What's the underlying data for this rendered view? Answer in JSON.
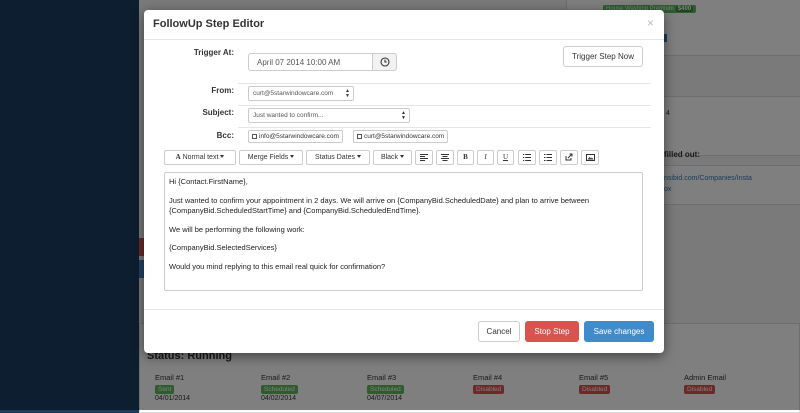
{
  "background": {
    "house_washing_label": "House Washing Premium",
    "house_washing_price": "$400",
    "number_fragment": "4",
    "filled_out_label": "filled out:",
    "link_line1": "nsibid.com/Companies/Insta",
    "link_line2": "ox",
    "status_title": "Status: Running",
    "emails": [
      {
        "header": "Email #1",
        "badge": "Sent",
        "date": "04/01/2014",
        "color": "#5cb85c"
      },
      {
        "header": "Email #2",
        "badge": "Scheduled",
        "date": "04/02/2014",
        "color": "#5cb85c"
      },
      {
        "header": "Email #3",
        "badge": "Scheduled",
        "date": "04/07/2014",
        "color": "#5cb85c"
      },
      {
        "header": "Email #4",
        "badge": "Disabled",
        "date": "",
        "color": "#d9534f"
      },
      {
        "header": "Email #5",
        "badge": "Disabled",
        "date": "",
        "color": "#d9534f"
      },
      {
        "header": "Admin Email",
        "badge": "Disabled",
        "date": "",
        "color": "#d9534f"
      }
    ]
  },
  "modal": {
    "title": "FollowUp Step Editor",
    "close_symbol": "×",
    "trigger_label": "Trigger At:",
    "trigger_value": "April 07 2014 10:00 AM",
    "trigger_now_button": "Trigger Step Now",
    "from_label": "From:",
    "from_value": "curt@5starwindowcare.com",
    "subject_label": "Subject:",
    "subject_value": "Just wanted to confirm...",
    "bcc_label": "Bcc:",
    "bcc_options": [
      "info@5starwindowcare.com",
      "curt@5starwindowcare.com"
    ],
    "toolbar": {
      "normal_text": "Normal text",
      "merge_fields": "Merge Fields",
      "status_dates": "Status Dates",
      "color": "Black",
      "bold": "B",
      "italic": "I",
      "underline": "U"
    },
    "body": {
      "p1": "Hi {Contact.FirstName},",
      "p2": "Just wanted to confirm your appointment in 2 days. We will arrive on {CompanyBid.ScheduledDate} and plan to arrive between {CompanyBid.ScheduledStartTime} and {CompanyBid.ScheduledEndTime}.",
      "p3": "We will be performing the following work:",
      "p4": "{CompanyBid.SelectedServices}",
      "p5": "Would you mind replying to this email real quick for confirmation?"
    },
    "cancel_button": "Cancel",
    "stop_button": "Stop Step",
    "save_button": "Save changes"
  },
  "colors": {
    "primary": "#428bca",
    "danger": "#d9534f",
    "success": "#5cb85c",
    "sidebar": "#1c3d63"
  }
}
